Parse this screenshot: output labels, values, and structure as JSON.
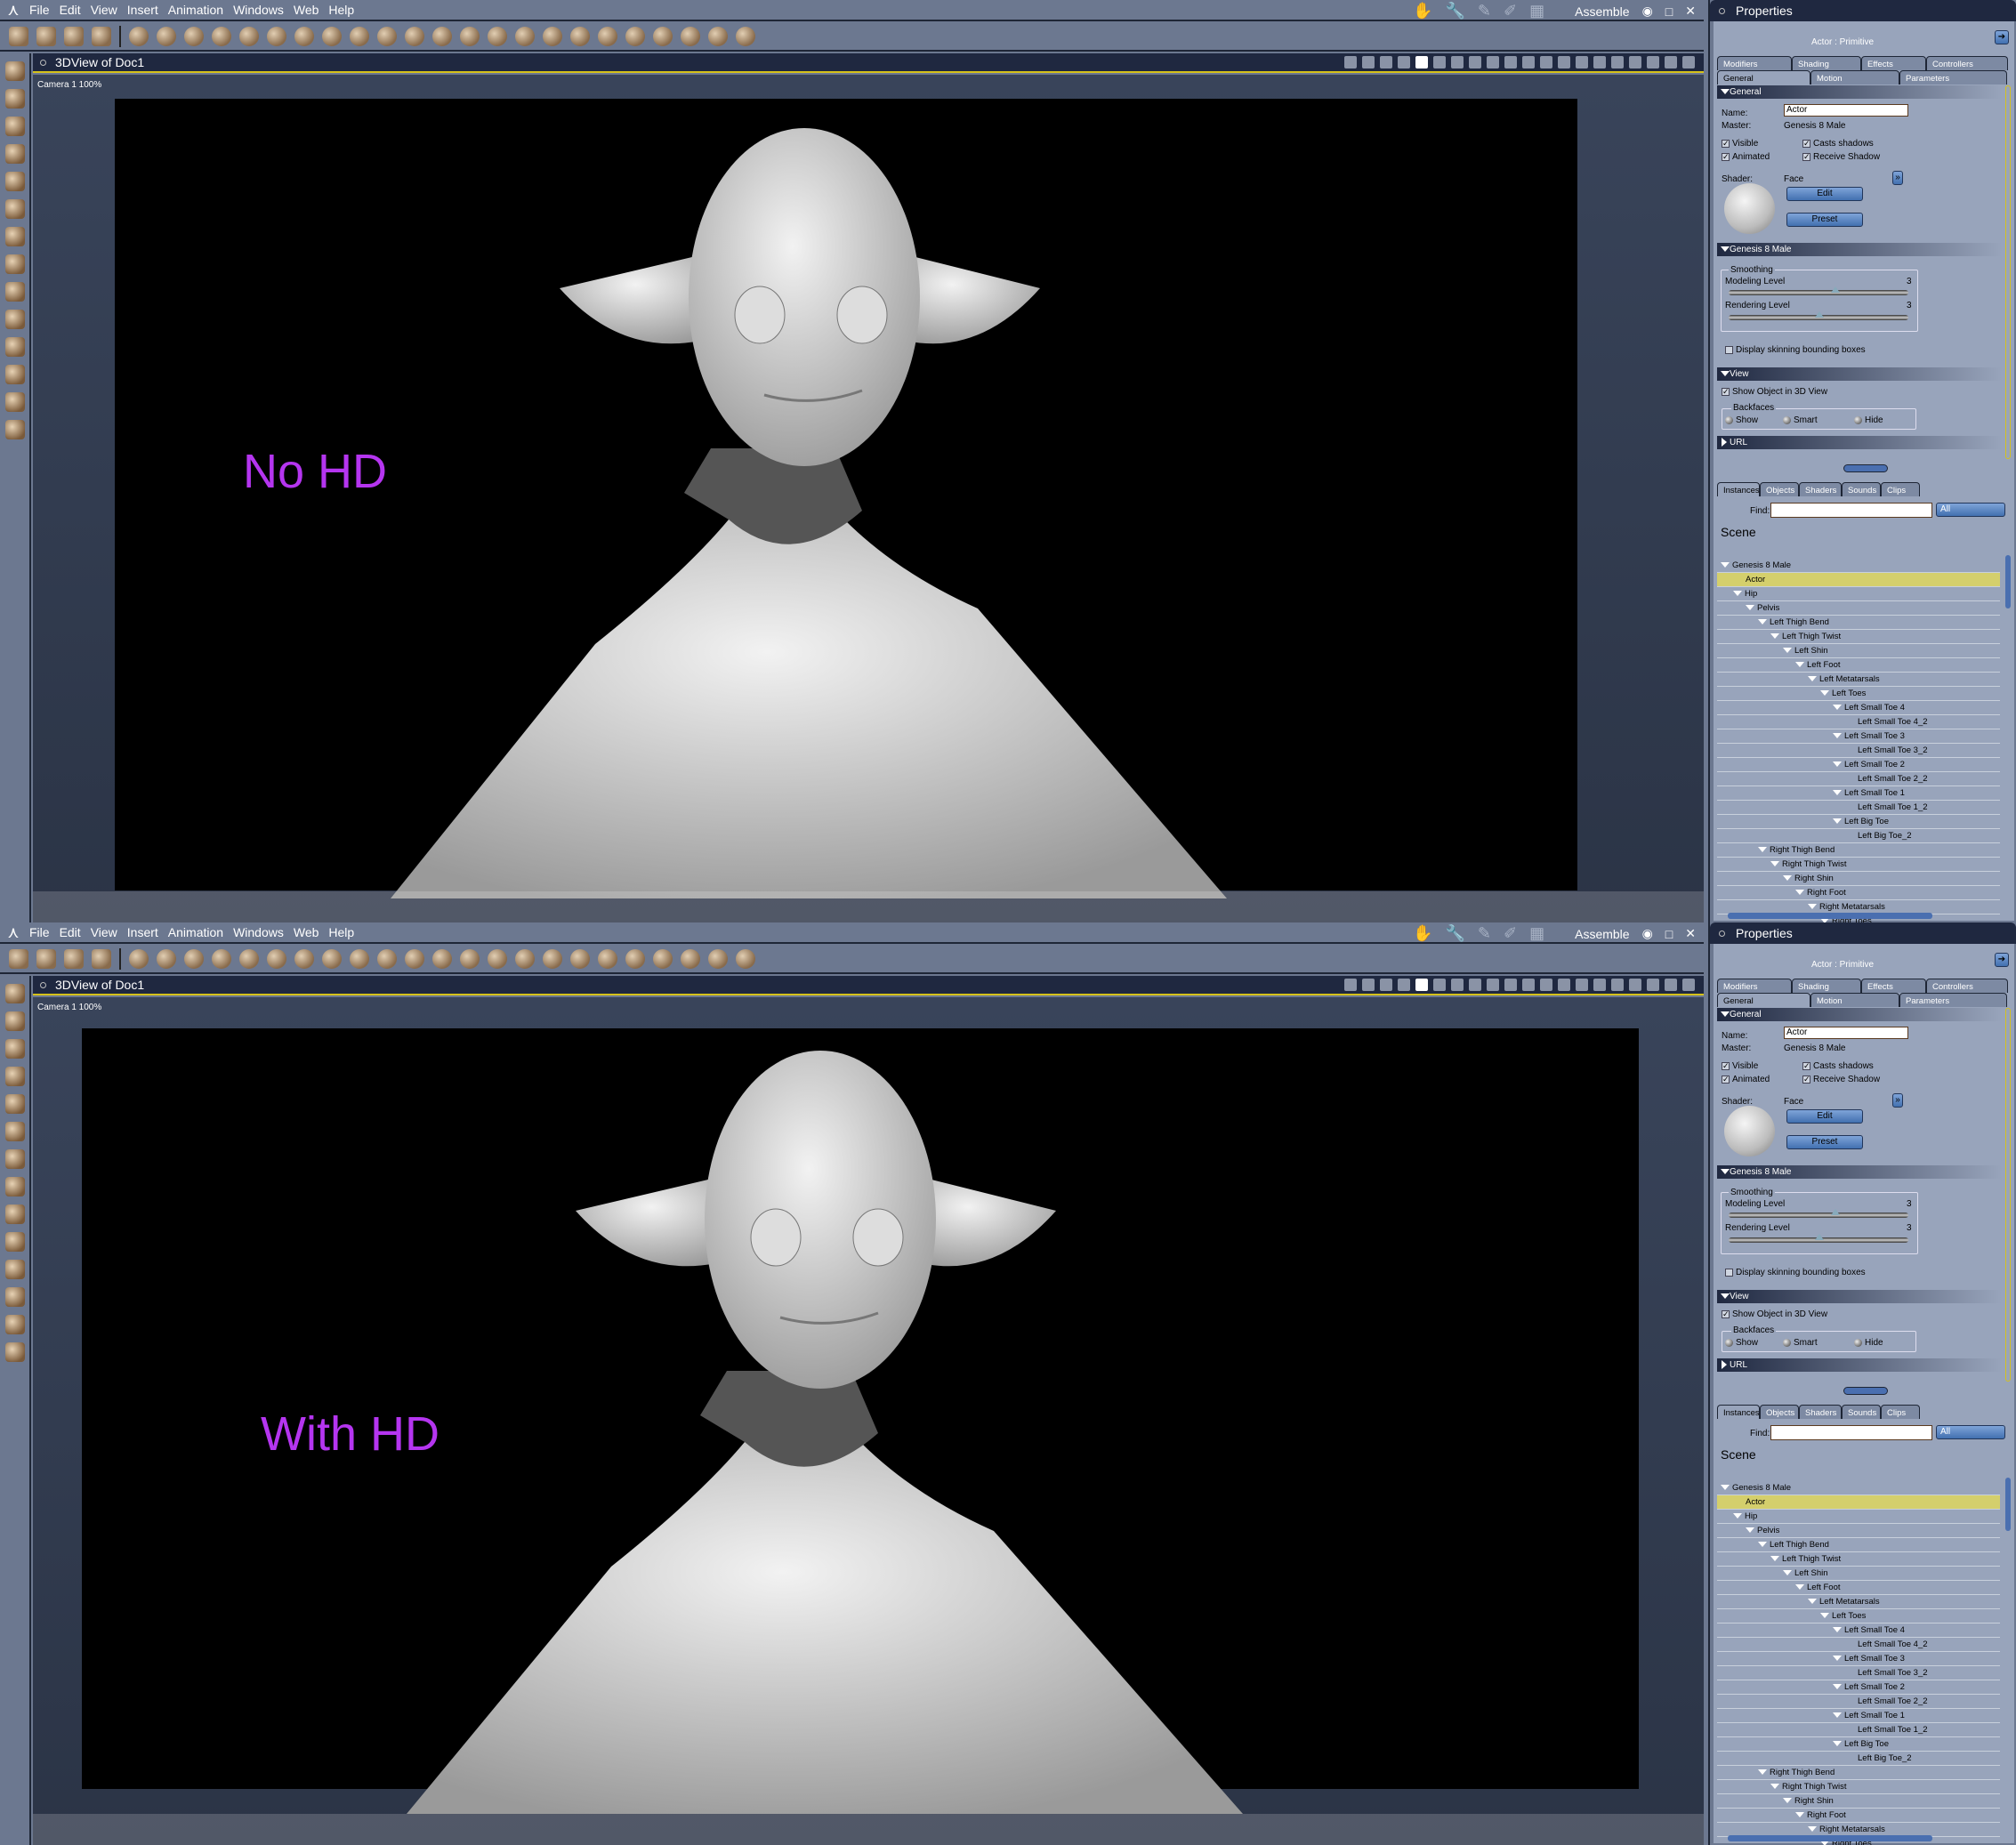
{
  "menu": {
    "items": [
      "File",
      "Edit",
      "View",
      "Insert",
      "Animation",
      "Windows",
      "Web",
      "Help"
    ],
    "room": "Assemble"
  },
  "view": {
    "title": "3DView of Doc1",
    "camera": "Camera 1 100%"
  },
  "panels": [
    {
      "label": "No HD"
    },
    {
      "label": "With HD"
    }
  ],
  "label_color": "#b535f0",
  "properties": {
    "title": "Properties",
    "subtitle": "Actor : Primitive",
    "tabs_row1": [
      "Modifiers",
      "Shading",
      "Effects",
      "Controllers"
    ],
    "tabs_row2": [
      "General",
      "Motion",
      "Parameters"
    ],
    "general": {
      "header": "General",
      "name_label": "Name:",
      "name_value": "Actor",
      "master_label": "Master:",
      "master_value": "Genesis 8 Male",
      "visible": "Visible",
      "animated": "Animated",
      "casts": "Casts shadows",
      "receive": "Receive Shadow",
      "shader_label": "Shader:",
      "shader_value": "Face",
      "edit": "Edit",
      "preset": "Preset"
    },
    "figure": {
      "header": "Genesis 8 Male",
      "smoothing": "Smoothing",
      "modeling": "Modeling Level",
      "modeling_value": "3",
      "rendering": "Rendering Level",
      "rendering_value": "3",
      "skinning": "Display skinning bounding boxes"
    },
    "viewsec": {
      "header": "View",
      "show": "Show Object in 3D View",
      "backfaces": "Backfaces",
      "opts": [
        "Show",
        "Smart",
        "Hide"
      ]
    },
    "url": "URL"
  },
  "library": {
    "tabs": [
      "Instances",
      "Objects",
      "Shaders",
      "Sounds",
      "Clips"
    ],
    "find_label": "Find:",
    "filter": "All",
    "scene": "Scene",
    "tree": [
      {
        "t": "Genesis 8 Male",
        "d": 0,
        "e": 1
      },
      {
        "t": "Actor",
        "d": 1,
        "e": 0,
        "sel": 1
      },
      {
        "t": "Hip",
        "d": 1,
        "e": 1
      },
      {
        "t": "Pelvis",
        "d": 2,
        "e": 1
      },
      {
        "t": "Left Thigh Bend",
        "d": 3,
        "e": 1
      },
      {
        "t": "Left Thigh Twist",
        "d": 4,
        "e": 1
      },
      {
        "t": "Left Shin",
        "d": 5,
        "e": 1
      },
      {
        "t": "Left Foot",
        "d": 6,
        "e": 1
      },
      {
        "t": "Left Metatarsals",
        "d": 7,
        "e": 1
      },
      {
        "t": "Left Toes",
        "d": 8,
        "e": 1
      },
      {
        "t": "Left Small Toe 4",
        "d": 9,
        "e": 1
      },
      {
        "t": "Left Small Toe 4_2",
        "d": 10,
        "e": 0
      },
      {
        "t": "Left Small Toe 3",
        "d": 9,
        "e": 1
      },
      {
        "t": "Left Small Toe 3_2",
        "d": 10,
        "e": 0
      },
      {
        "t": "Left Small Toe 2",
        "d": 9,
        "e": 1
      },
      {
        "t": "Left Small Toe 2_2",
        "d": 10,
        "e": 0
      },
      {
        "t": "Left Small Toe 1",
        "d": 9,
        "e": 1
      },
      {
        "t": "Left Small Toe 1_2",
        "d": 10,
        "e": 0
      },
      {
        "t": "Left Big Toe",
        "d": 9,
        "e": 1
      },
      {
        "t": "Left Big Toe_2",
        "d": 10,
        "e": 0
      },
      {
        "t": "Right Thigh Bend",
        "d": 3,
        "e": 1
      },
      {
        "t": "Right Thigh Twist",
        "d": 4,
        "e": 1
      },
      {
        "t": "Right Shin",
        "d": 5,
        "e": 1
      },
      {
        "t": "Right Foot",
        "d": 6,
        "e": 1
      },
      {
        "t": "Right Metatarsals",
        "d": 7,
        "e": 1
      },
      {
        "t": "Right Toes",
        "d": 8,
        "e": 1
      }
    ]
  }
}
